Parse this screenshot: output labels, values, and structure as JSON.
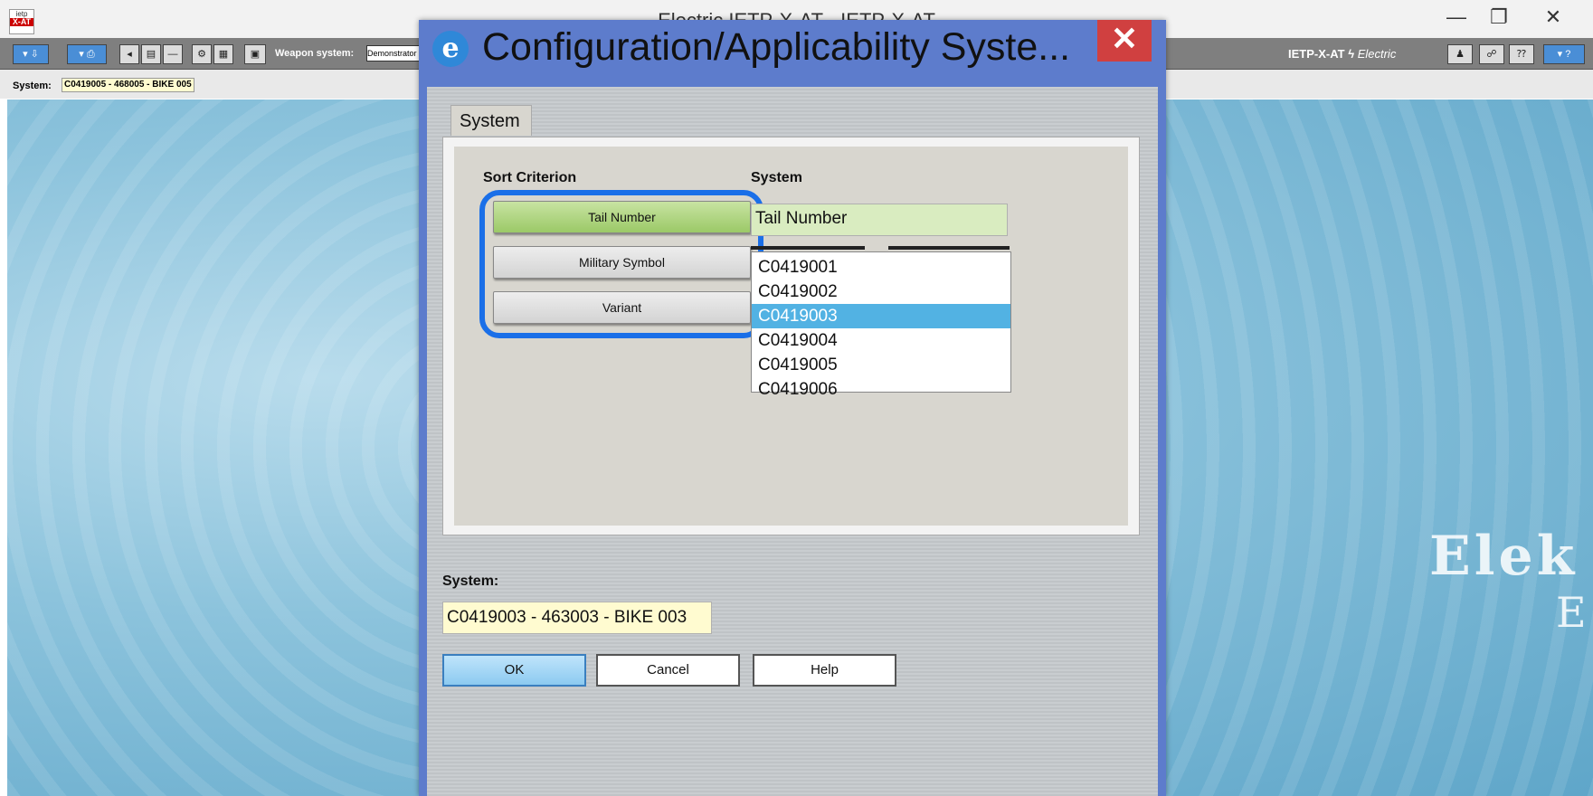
{
  "window": {
    "title": "Electric IETP-X-AT - IETP-X-AT",
    "minimize": "—",
    "maximize": "❐",
    "close": "✕",
    "app_icon_top": "ietp",
    "app_icon_bottom": "X-AT"
  },
  "toolbar": {
    "weapon_system_label": "Weapon system:",
    "weapon_system_value": "Demonstrator",
    "brand": "IETP-X-AT",
    "brand_suffix": "Electric",
    "help_label": "?"
  },
  "statusbar": {
    "system_label": "System:",
    "system_value": "C0419005 - 468005 - BIKE 005"
  },
  "background": {
    "text1": "Elek",
    "text2": "E"
  },
  "dialog": {
    "title": "Configuration/Applicability Syste...",
    "close_label": "✕",
    "tab_label": "System",
    "sort_heading": "Sort Criterion",
    "sort_buttons": [
      "Tail Number",
      "Military Symbol",
      "Variant"
    ],
    "sort_selected_index": 0,
    "system_heading": "System",
    "system_value": "Tail Number",
    "list_items": [
      "C0419001",
      "C0419002",
      "C0419003",
      "C0419004",
      "C0419005",
      "C0419006"
    ],
    "list_selected_index": 2,
    "bottom_label": "System:",
    "bottom_value": "C0419003 - 463003 - BIKE 003",
    "ok_label": "OK",
    "cancel_label": "Cancel",
    "help_label": "Help",
    "highlight_color": "#1a6fe8",
    "selected_color": "#52b2e3"
  }
}
